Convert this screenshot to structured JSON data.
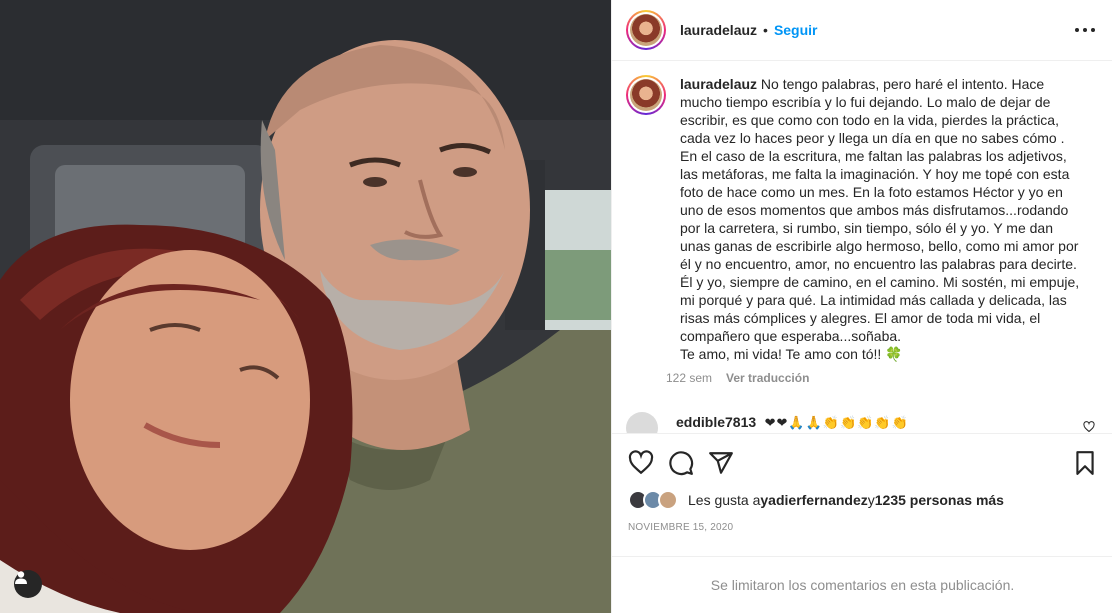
{
  "post": {
    "username": "lauradelauz",
    "dot": "•",
    "follow_label": "Seguir",
    "more_icon": "more-horizontal-icon"
  },
  "caption": {
    "username": "lauradelauz",
    "text": "No tengo palabras, pero haré el intento. Hace mucho tiempo escribía y lo fui dejando. Lo malo de dejar de escribir, es que como con todo en la vida, pierdes la práctica, cada vez lo haces peor y llega un día en que no sabes cómo . En el caso de la escritura, me faltan las palabras los adjetivos, las metáforas, me falta la imaginación. Y hoy me topé con esta foto de hace como un mes. En la foto estamos Héctor y yo en uno de esos momentos que ambos más disfrutamos...rodando por la carretera, si rumbo, sin tiempo, sólo él y yo. Y me dan unas ganas de escribirle algo hermoso, bello, como mi amor por él y no encuentro, amor, no encuentro las palabras para decirte.\nÉl y yo, siempre de camino, en el camino. Mi sostén, mi empuje, mi porqué y para qué. La intimidad más callada y delicada, las risas más cómplices y alegres. El amor de toda mi vida, el compañero que esperaba...soñaba.\nTe amo, mi vida! Te amo con tó!! ",
    "emoji": "🍀",
    "time": "122 sem",
    "translate": "Ver traducción"
  },
  "comment": {
    "username": "eddible7813",
    "emojis": "❤❤🙏🙏👏👏👏👏👏"
  },
  "likes": {
    "prefix": "Les gusta a ",
    "user": "yadierfernandez",
    "middle": " y ",
    "count": "1235 personas más"
  },
  "date": "NOVIEMBRE 15, 2020",
  "limited_text": "Se limitaron los comentarios en esta publicación.",
  "colors": {
    "link": "#0095f6",
    "text": "#262626",
    "muted": "#8e8e8e",
    "border": "#efefef"
  }
}
